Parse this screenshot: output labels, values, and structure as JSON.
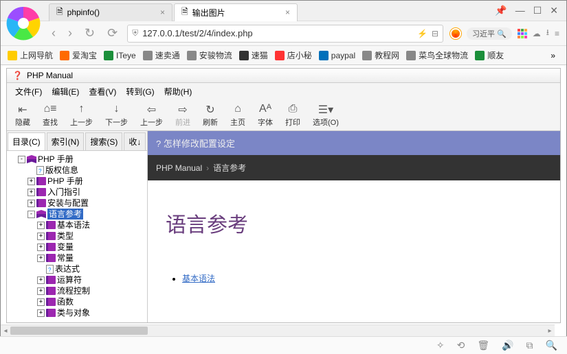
{
  "tabs": [
    {
      "label": "phpinfo()",
      "active": false
    },
    {
      "label": "输出图片",
      "active": true
    }
  ],
  "window_controls": {
    "pin": "📌",
    "min": "—",
    "max": "☐",
    "close": "✕"
  },
  "address": {
    "url": "127.0.0.1/test/2/4/index.php",
    "search_label": "习近平"
  },
  "bookmarks": [
    {
      "label": "上网导航",
      "color": "#ffcc00"
    },
    {
      "label": "爱淘宝",
      "color": "#ff6a00"
    },
    {
      "label": "ITeye",
      "color": "#1b8f3a"
    },
    {
      "label": "速卖通",
      "color": "#888"
    },
    {
      "label": "安骏物流",
      "color": "#888"
    },
    {
      "label": "速猫",
      "color": "#333"
    },
    {
      "label": "店小秘",
      "color": "#f33"
    },
    {
      "label": "paypal",
      "color": "#0070ba"
    },
    {
      "label": "教程网",
      "color": "#888"
    },
    {
      "label": "菜鸟全球物流",
      "color": "#888"
    },
    {
      "label": "顺友",
      "color": "#1b8f3a"
    }
  ],
  "chm": {
    "title": "PHP Manual",
    "menu": [
      "文件(F)",
      "编辑(E)",
      "查看(V)",
      "转到(G)",
      "帮助(H)"
    ],
    "toolbar": [
      {
        "label": "隐藏",
        "icon": "⇤",
        "disabled": false
      },
      {
        "label": "查找",
        "icon": "⌂≡",
        "disabled": false
      },
      {
        "label": "上一步",
        "icon": "↑",
        "disabled": false
      },
      {
        "label": "下一步",
        "icon": "↓",
        "disabled": false
      },
      {
        "label": "上一步",
        "icon": "⇦",
        "disabled": false
      },
      {
        "label": "前进",
        "icon": "⇨",
        "disabled": true
      },
      {
        "label": "刷新",
        "icon": "↻",
        "disabled": false
      },
      {
        "label": "主页",
        "icon": "⌂",
        "disabled": false
      },
      {
        "label": "字体",
        "icon": "Aᴬ",
        "disabled": false
      },
      {
        "label": "打印",
        "icon": "⎙",
        "disabled": false
      },
      {
        "label": "选项(O)",
        "icon": "☰▾",
        "disabled": false
      }
    ],
    "nav_tabs": [
      "目录(C)",
      "索引(N)",
      "搜索(S)",
      "收↓"
    ],
    "tree": {
      "root": "PHP 手册",
      "items": [
        {
          "label": "版权信息",
          "type": "page"
        },
        {
          "label": "PHP 手册",
          "type": "book",
          "exp": "+"
        },
        {
          "label": "入门指引",
          "type": "book",
          "exp": "+"
        },
        {
          "label": "安装与配置",
          "type": "book",
          "exp": "+"
        }
      ],
      "lang_ref": {
        "label": "语言参考",
        "children": [
          {
            "label": "基本语法",
            "exp": "+"
          },
          {
            "label": "类型",
            "exp": "+"
          },
          {
            "label": "变量",
            "exp": "+"
          },
          {
            "label": "常量",
            "exp": "+"
          },
          {
            "label": "表达式",
            "exp": "",
            "type": "page"
          },
          {
            "label": "运算符",
            "exp": "+"
          },
          {
            "label": "流程控制",
            "exp": "+"
          },
          {
            "label": "函数",
            "exp": "+"
          },
          {
            "label": "类与对象",
            "exp": "+"
          }
        ]
      }
    },
    "doc": {
      "topbar": "? 怎样修改配置设定",
      "breadcrumb_root": "PHP Manual",
      "breadcrumb_current": "语言参考",
      "heading": "语言参考",
      "link1": "基本语法"
    }
  }
}
